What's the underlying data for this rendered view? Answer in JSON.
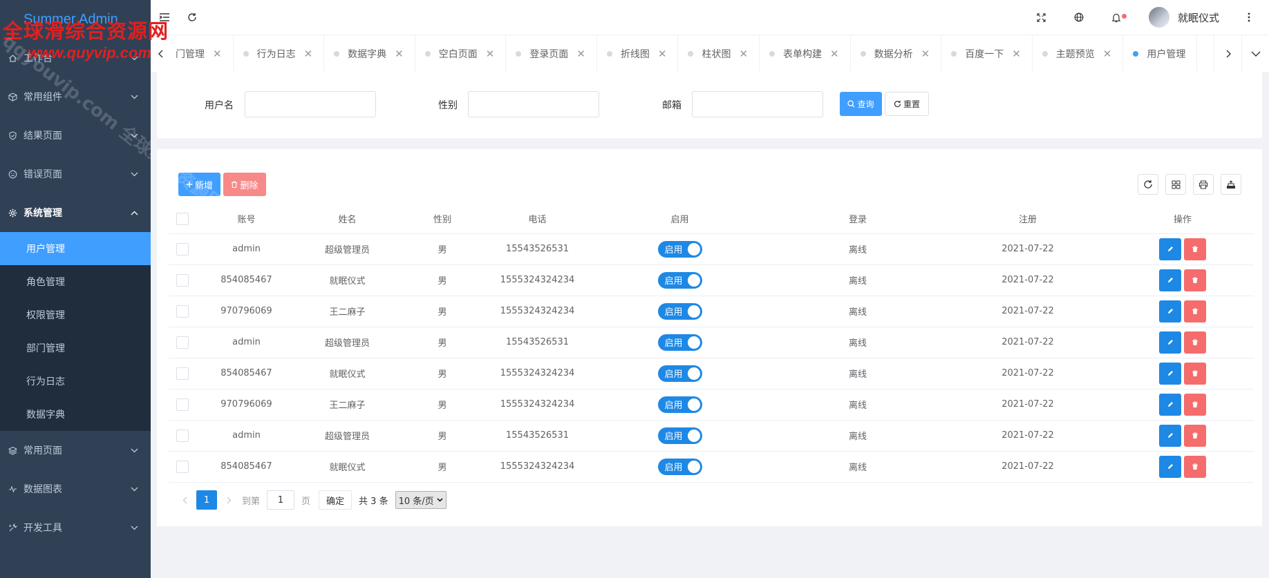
{
  "app": {
    "logo": "Summer Admin"
  },
  "sidebar": {
    "items": [
      {
        "label": "工作台",
        "icon": "home-icon"
      },
      {
        "label": "常用组件",
        "icon": "box-icon"
      },
      {
        "label": "结果页面",
        "icon": "shield-check-icon"
      },
      {
        "label": "错误页面",
        "icon": "sad-face-icon"
      },
      {
        "label": "系统管理",
        "icon": "gear-icon",
        "open": true
      },
      {
        "label": "常用页面",
        "icon": "layers-icon"
      },
      {
        "label": "数据图表",
        "icon": "pulse-icon"
      },
      {
        "label": "开发工具",
        "icon": "tools-icon"
      }
    ],
    "submenu": [
      {
        "label": "用户管理",
        "active": true
      },
      {
        "label": "角色管理"
      },
      {
        "label": "权限管理"
      },
      {
        "label": "部门管理"
      },
      {
        "label": "行为日志"
      },
      {
        "label": "数据字典"
      }
    ]
  },
  "header": {
    "user_name": "就眠仪式"
  },
  "tabs": [
    {
      "label": "门管理"
    },
    {
      "label": "行为日志"
    },
    {
      "label": "数据字典"
    },
    {
      "label": "空白页面"
    },
    {
      "label": "登录页面"
    },
    {
      "label": "折线图"
    },
    {
      "label": "柱状图"
    },
    {
      "label": "表单构建"
    },
    {
      "label": "数据分析"
    },
    {
      "label": "百度一下"
    },
    {
      "label": "主题预览"
    },
    {
      "label": "用户管理",
      "active": true
    }
  ],
  "search": {
    "username_label": "用户名",
    "gender_label": "性别",
    "email_label": "邮箱",
    "query_label": "查询",
    "reset_label": "重置"
  },
  "toolbar": {
    "add_label": "新增",
    "delete_label": "删除"
  },
  "table": {
    "columns": [
      "账号",
      "姓名",
      "性别",
      "电话",
      "启用",
      "登录",
      "注册",
      "操作"
    ],
    "rows": [
      {
        "account": "admin",
        "name": "超级管理员",
        "gender": "男",
        "phone": "15543526531",
        "enabled": "启用",
        "login": "离线",
        "registered": "2021-07-22"
      },
      {
        "account": "854085467",
        "name": "就眠仪式",
        "gender": "男",
        "phone": "1555324324234",
        "enabled": "启用",
        "login": "离线",
        "registered": "2021-07-22"
      },
      {
        "account": "970796069",
        "name": "王二麻子",
        "gender": "男",
        "phone": "1555324324234",
        "enabled": "启用",
        "login": "离线",
        "registered": "2021-07-22"
      },
      {
        "account": "admin",
        "name": "超级管理员",
        "gender": "男",
        "phone": "15543526531",
        "enabled": "启用",
        "login": "离线",
        "registered": "2021-07-22"
      },
      {
        "account": "854085467",
        "name": "就眠仪式",
        "gender": "男",
        "phone": "1555324324234",
        "enabled": "启用",
        "login": "离线",
        "registered": "2021-07-22"
      },
      {
        "account": "970796069",
        "name": "王二麻子",
        "gender": "男",
        "phone": "1555324324234",
        "enabled": "启用",
        "login": "离线",
        "registered": "2021-07-22"
      },
      {
        "account": "admin",
        "name": "超级管理员",
        "gender": "男",
        "phone": "15543526531",
        "enabled": "启用",
        "login": "离线",
        "registered": "2021-07-22"
      },
      {
        "account": "854085467",
        "name": "就眠仪式",
        "gender": "男",
        "phone": "1555324324234",
        "enabled": "启用",
        "login": "离线",
        "registered": "2021-07-22"
      }
    ]
  },
  "pagination": {
    "current_page": "1",
    "goto_label": "到第",
    "goto_value": "1",
    "page_unit": "页",
    "confirm_label": "确定",
    "total_label": "共 3 条",
    "page_size": "10 条/页"
  },
  "watermark": {
    "line1": "全球滑综合资源网",
    "line2": "www.quyvip.com",
    "diag": "qqyouvip.com 全球综合资源网"
  },
  "colors": {
    "sidebar_bg": "#304156",
    "submenu_bg": "#1f2d3d",
    "accent": "#409eff",
    "danger": "#f56c6c",
    "switch_on": "#1e88e5"
  }
}
